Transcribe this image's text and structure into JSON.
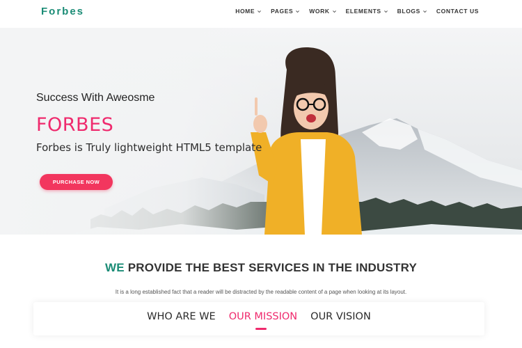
{
  "nav": {
    "logo": "Forbes",
    "items": [
      {
        "label": "HOME",
        "dropdown": true
      },
      {
        "label": "PAGES",
        "dropdown": true
      },
      {
        "label": "WORK",
        "dropdown": true
      },
      {
        "label": "ELEMENTS",
        "dropdown": true
      },
      {
        "label": "BLOGS",
        "dropdown": true
      },
      {
        "label": "CONTACT US",
        "dropdown": false
      }
    ]
  },
  "hero": {
    "subtitle": "Success With Aweosme",
    "title": "FORBES",
    "description": "Forbes is Truly lightweight HTML5 template",
    "button_label": "PURCHASE NOW"
  },
  "services": {
    "heading_accent": "WE",
    "heading_rest": " PROVIDE THE BEST SERVICES IN THE INDUSTRY",
    "description": "It is a long established fact that a reader will be distracted by the readable content of a page when looking at its layout."
  },
  "tabs": {
    "items": [
      "WHO ARE WE",
      "OUR MISSION",
      "OUR VISION"
    ],
    "active": "OUR MISSION"
  },
  "colors": {
    "brand_green": "#1b8c76",
    "accent_pink": "#ef2a6d",
    "button_pink": "#f2365e",
    "text_dark": "#2d2d2d"
  },
  "icons": {
    "nav_dropdown": "chevron-down-icon"
  }
}
